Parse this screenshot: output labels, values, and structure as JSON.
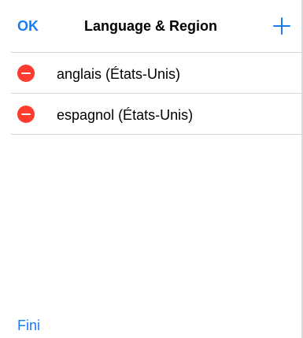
{
  "nav": {
    "ok_label": "OK",
    "title": "Language & Region",
    "add_icon": "plus-icon"
  },
  "languages": [
    {
      "label": "anglais (États-Unis)",
      "delete_icon": "minus-circle-icon"
    },
    {
      "label": "espagnol (États-Unis)",
      "delete_icon": "minus-circle-icon"
    }
  ],
  "footer": {
    "done_label": "Fini"
  },
  "colors": {
    "accent": "#1a7cf5",
    "delete": "#ff3b30",
    "divider": "#d8d8dc"
  }
}
